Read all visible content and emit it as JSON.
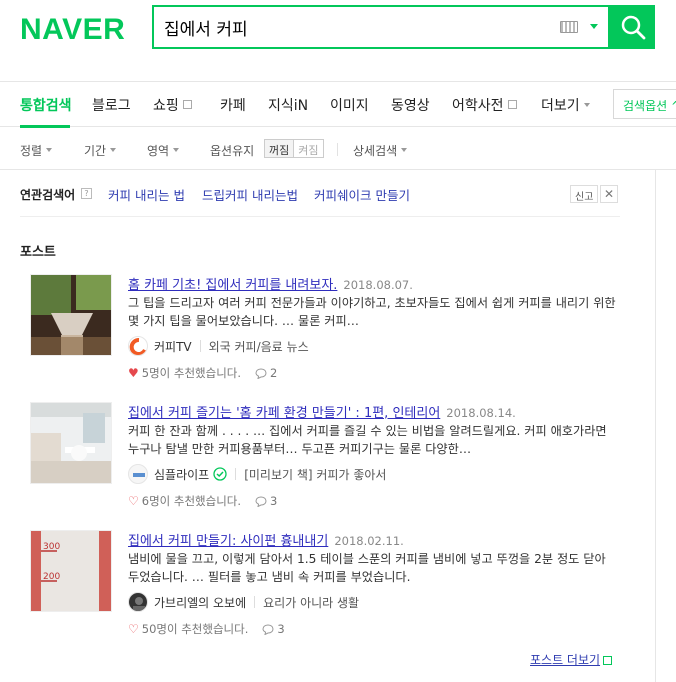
{
  "header": {
    "logo": "NAVER",
    "search_value": "집에서 커피"
  },
  "tabs": [
    {
      "label": "통합검색",
      "active": true
    },
    {
      "label": "블로그"
    },
    {
      "label": "쇼핑"
    },
    {
      "label": "카페"
    },
    {
      "label": "지식iN"
    },
    {
      "label": "이미지"
    },
    {
      "label": "동영상"
    },
    {
      "label": "어학사전"
    },
    {
      "label": "더보기"
    }
  ],
  "search_options_label": "검색옵션 ^",
  "filters": {
    "sort": "정렬",
    "period": "기간",
    "area": "영역",
    "keep_option": "옵션유지",
    "toggle_on": "꺼짐",
    "toggle_off": "켜짐",
    "detail": "상세검색"
  },
  "related": {
    "title": "연관검색어",
    "links": [
      "커피 내리는 법",
      "드립커피 내리는법",
      "커피쉐이크 만들기"
    ],
    "report": "신고"
  },
  "section_title": "포스트",
  "posts": [
    {
      "title": "홈 카페 기초! 집에서 커피를 내려보자.",
      "date": "2018.08.07.",
      "desc": "그 팁을 드리고자 여러 커피 전문가들과 이야기하고, 초보자들도 집에서 쉽게 커피를 내리기 위한 몇 가지 팁을 물어보았습니다.            … 물론 커피…",
      "source": "커피TV",
      "category": "외국 커피/음료 뉴스",
      "likes": "5명이 추천했습니다.",
      "comments": "2"
    },
    {
      "title": "집에서 커피 즐기는 '홈 카페 환경 만들기' : 1편, 인테리어",
      "date": "2018.08.14.",
      "desc": "커피 한 잔과 함께 . . . . … 집에서 커피를 즐길 수 있는 비법을 알려드릴게요. 커피 애호가라면 누구나 탐낼 만한 커피용품부터… 두고픈 커피기구는 물론 다양한…",
      "source": "심플라이프",
      "category": "[미리보기 책] 커피가 좋아서",
      "likes": "6명이 추천했습니다.",
      "comments": "3"
    },
    {
      "title": "집에서 커피 만들기: 사이펀 흉내내기",
      "date": "2018.02.11.",
      "desc": "냄비에 물을 끄고, 이렇게 담아서 1.5 테이블 스푼의 커피를 냄비에 넣고 뚜껑을 2분 정도 닫아 두었습니다. … 필터를 놓고 냄비 속 커피를 부었습니다.",
      "source": "가브리엘의 오보에",
      "category": "요리가 아니라 생활",
      "likes": "50명이 추천했습니다.",
      "comments": "3"
    }
  ],
  "more_label": "포스트 더보기",
  "colors": {
    "brand": "#03c75a",
    "link": "#2f3cb0"
  }
}
